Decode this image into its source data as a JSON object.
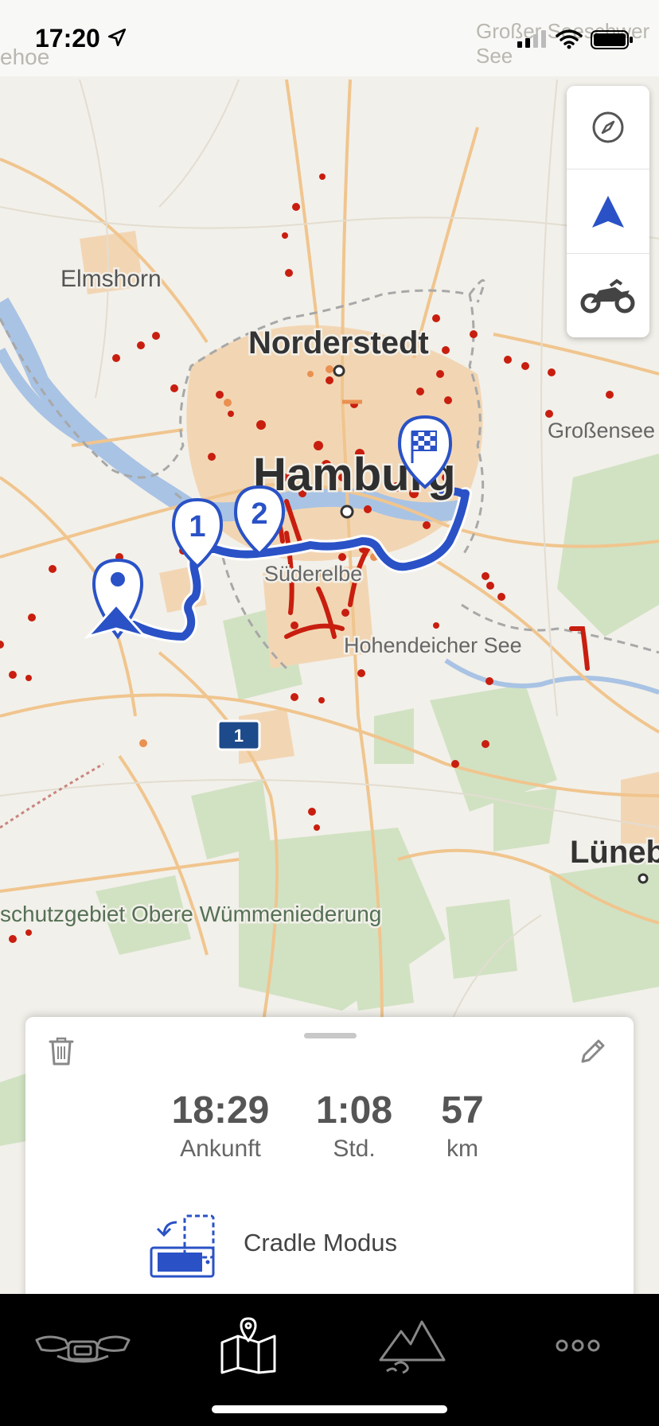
{
  "status_bar": {
    "time": "17:20",
    "faint_left": "ehoe",
    "faint_right": "Großer Seeschwer See"
  },
  "map": {
    "places": [
      {
        "name": "Elmshorn"
      },
      {
        "name": "Norderstedt"
      },
      {
        "name": "Hamburg"
      },
      {
        "name": "Großensee"
      },
      {
        "name": "Süderelbe"
      },
      {
        "name": "Hohendeicher See"
      },
      {
        "name": "Lüneb"
      },
      {
        "name": "schutzgebiet Obere Wümmeniederung"
      }
    ],
    "road_shield": "1",
    "waypoint_1": "1",
    "waypoint_2": "2"
  },
  "map_controls": [
    {
      "icon": "compass-icon"
    },
    {
      "icon": "navigation-arrow-icon"
    },
    {
      "icon": "motorcycle-icon"
    }
  ],
  "route_sheet": {
    "arrival_value": "18:29",
    "arrival_label": "Ankunft",
    "duration_value": "1:08",
    "duration_label": "Std.",
    "distance_value": "57",
    "distance_label": "km",
    "cradle_label": "Cradle Modus"
  },
  "tabs": [
    {
      "icon": "motorcycle-dashboard-icon",
      "selected": false
    },
    {
      "icon": "map-pin-icon",
      "selected": true
    },
    {
      "icon": "mountains-icon",
      "selected": false
    },
    {
      "icon": "more-dots-icon",
      "selected": false
    }
  ],
  "colors": {
    "route": "#2a52c6",
    "traffic": "#c81e0f",
    "water": "#a9c3e4",
    "forest": "#cfe2c0",
    "urban": "#f2d3ae"
  }
}
